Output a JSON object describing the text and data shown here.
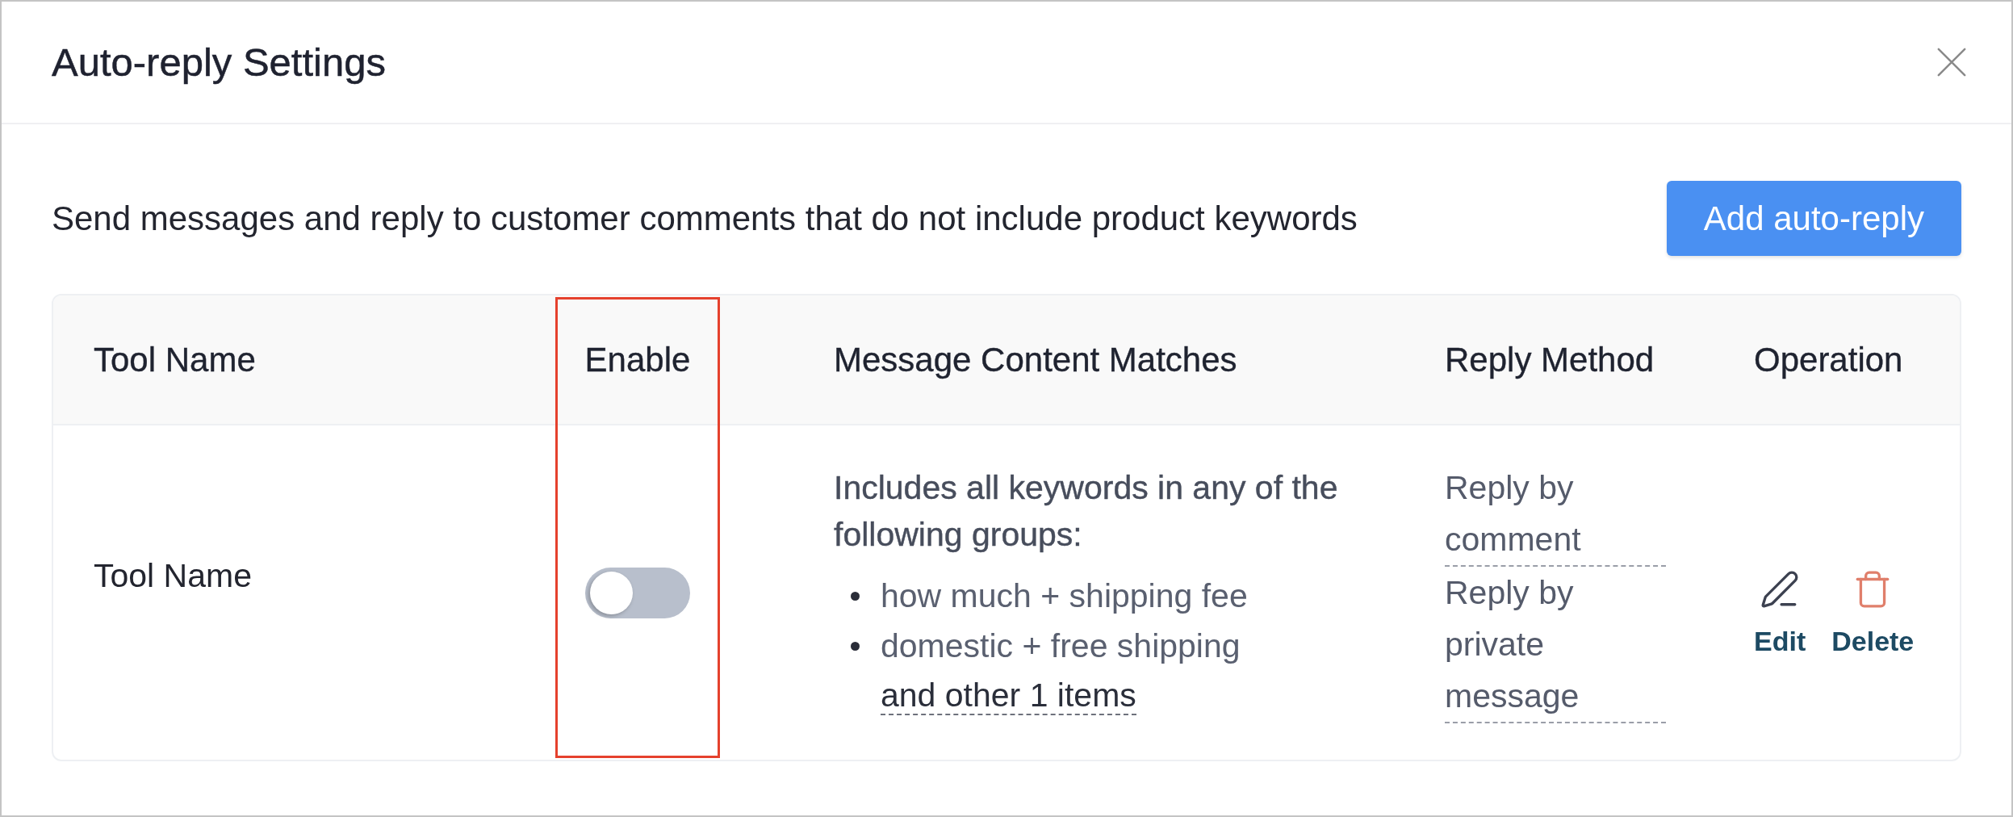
{
  "dialog": {
    "title": "Auto-reply Settings"
  },
  "description": "Send messages and reply to customer comments that do not include product keywords",
  "add_button": {
    "label": "Add auto-reply"
  },
  "table": {
    "columns": [
      {
        "label": "Tool Name",
        "highlighted": false
      },
      {
        "label": "Enable",
        "highlighted": true
      },
      {
        "label": "Message Content Matches",
        "highlighted": false
      },
      {
        "label": "Reply Method",
        "highlighted": false
      },
      {
        "label": "Operation",
        "highlighted": false
      }
    ],
    "rows": [
      {
        "tool_name": "Tool Name",
        "enabled": false,
        "match": {
          "summary": "Includes all keywords in any of the following groups:",
          "groups": [
            "how much + shipping fee",
            "domestic + free shipping"
          ],
          "more": "and other 1 items"
        },
        "reply_methods": [
          "Reply by comment",
          "Reply by private message"
        ],
        "actions": [
          {
            "kind": "edit",
            "label": "Edit"
          },
          {
            "kind": "delete",
            "label": "Delete"
          }
        ]
      }
    ]
  }
}
